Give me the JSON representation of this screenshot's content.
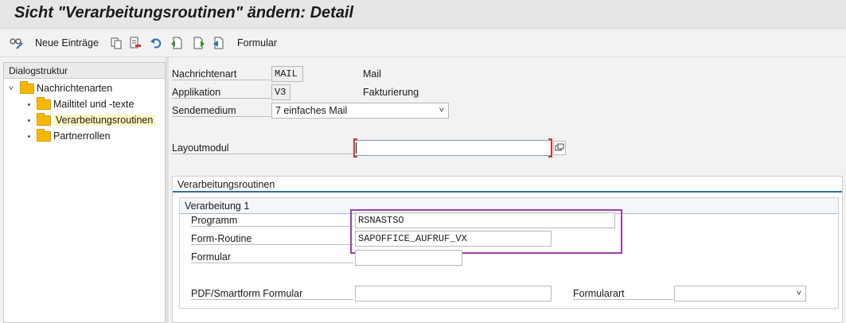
{
  "title": "Sicht \"Verarbeitungsroutinen\" ändern: Detail",
  "toolbar": {
    "neue_eintraege": "Neue Einträge",
    "formular": "Formular"
  },
  "dialog": {
    "header": "Dialogstruktur",
    "items": [
      {
        "label": "Nachrichtenarten"
      },
      {
        "label": "Mailtitel und -texte"
      },
      {
        "label": "Verarbeitungsroutinen"
      },
      {
        "label": "Partnerrollen"
      }
    ]
  },
  "form": {
    "nachrichtenart_label": "Nachrichtenart",
    "nachrichtenart_value": "MAIL",
    "nachrichtenart_text": "Mail",
    "applikation_label": "Applikation",
    "applikation_value": "V3",
    "applikation_text": "Fakturierung",
    "sendemedium_label": "Sendemedium",
    "sendemedium_value": "7 einfaches Mail",
    "layoutmodul_label": "Layoutmodul",
    "layoutmodul_value": ""
  },
  "routinen": {
    "header": "Verarbeitungsroutinen",
    "sub_header": "Verarbeitung 1",
    "programm_label": "Programm",
    "programm_value": "RSNASTSO",
    "formroutine_label": "Form-Routine",
    "formroutine_value": "SAPOFFICE_AUFRUF_VX",
    "formular_label": "Formular",
    "formular_value": "",
    "pdf_label": "PDF/Smartform Formular",
    "pdf_value": "",
    "formularart_label": "Formularart",
    "formularart_value": ""
  },
  "colors": {
    "highlight": "#9c3fa3",
    "section_line": "#2f6f9f",
    "folder": "#f5b800",
    "selected_bg": "#fff7c2"
  }
}
